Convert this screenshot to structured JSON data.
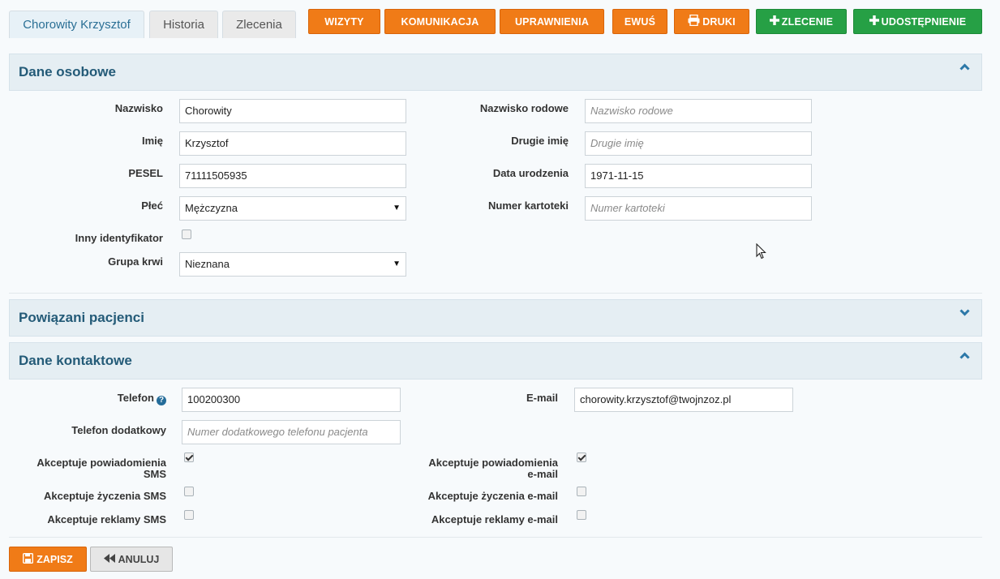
{
  "tabs": [
    "Chorowity Krzysztof",
    "Historia",
    "Zlecenia"
  ],
  "actions": {
    "wizyty": "WIZYTY",
    "komunikacja": "KOMUNIKACJA",
    "uprawnienia": "UPRAWNIENIA",
    "ewus": "EWUŚ",
    "druki": "DRUKI",
    "zlecenie": "ZLECENIE",
    "udostepnienie": "UDOSTĘPNIENIE"
  },
  "personal": {
    "title": "Dane osobowe",
    "nazwisko_label": "Nazwisko",
    "nazwisko_value": "Chorowity",
    "imie_label": "Imię",
    "imie_value": "Krzysztof",
    "pesel_label": "PESEL",
    "pesel_value": "71111505935",
    "plec_label": "Płeć",
    "plec_value": "Mężczyzna",
    "inny_label": "Inny identyfikator",
    "grupa_label": "Grupa krwi",
    "grupa_value": "Nieznana",
    "nazwisko_rodowe_label": "Nazwisko rodowe",
    "nazwisko_rodowe_placeholder": "Nazwisko rodowe",
    "drugie_imie_label": "Drugie imię",
    "drugie_imie_placeholder": "Drugie imię",
    "data_urodzenia_label": "Data urodzenia",
    "data_urodzenia_value": "1971-11-15",
    "numer_kartoteki_label": "Numer kartoteki",
    "numer_kartoteki_placeholder": "Numer kartoteki"
  },
  "related": {
    "title": "Powiązani pacjenci"
  },
  "contact": {
    "title": "Dane kontaktowe",
    "telefon_label": "Telefon",
    "telefon_value": "100200300",
    "telefon_dod_label": "Telefon dodatkowy",
    "telefon_dod_placeholder": "Numer dodatkowego telefonu pacjenta",
    "email_label": "E-mail",
    "email_value": "chorowity.krzysztof@twojnzoz.pl",
    "sms_notif_label_1": "Akceptuje powiadomienia",
    "sms_notif_label_2": "SMS",
    "sms_wishes_label": "Akceptuje życzenia SMS",
    "sms_ads_label": "Akceptuje reklamy SMS",
    "email_notif_label_1": "Akceptuje powiadomienia",
    "email_notif_label_2": "e-mail",
    "email_wishes_label": "Akceptuje życzenia e-mail",
    "email_ads_label": "Akceptuje reklamy e-mail"
  },
  "footer": {
    "save": "ZAPISZ",
    "cancel": "ANULUJ"
  }
}
